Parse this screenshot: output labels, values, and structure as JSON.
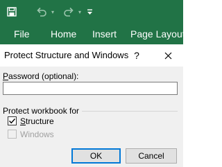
{
  "ribbon": {
    "tabs": [
      "File",
      "Home",
      "Insert",
      "Page Layout"
    ],
    "accent_color": "#217346",
    "quick_access": [
      "save-icon",
      "undo-icon",
      "redo-icon",
      "customize-icon"
    ]
  },
  "dialog": {
    "title": "Protect Structure and Windows",
    "help_label": "?",
    "password_label_hotkey": "P",
    "password_label_rest": "assword (optional):",
    "password_value": "",
    "group_label": "Protect workbook for",
    "structure_hotkey": "S",
    "structure_rest": "tructure",
    "structure_checked": true,
    "windows_label": "Windows",
    "windows_checked": false,
    "windows_enabled": false,
    "ok_label": "OK",
    "cancel_label": "Cancel"
  }
}
